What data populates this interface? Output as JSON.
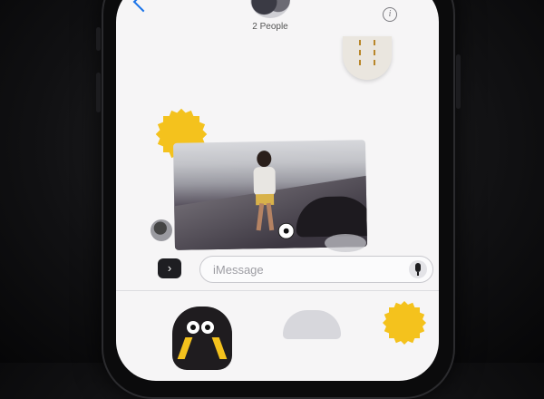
{
  "header": {
    "group_label": "2 People",
    "info_symbol": "i",
    "icons": {
      "back": "chevron-left-icon",
      "group_avatar": "group-avatar-icon",
      "info": "info-icon"
    }
  },
  "composer": {
    "placeholder": "iMessage",
    "apps_symbol": "›",
    "icons": {
      "apps": "app-drawer-icon",
      "mic": "microphone-icon"
    }
  },
  "colors": {
    "accent_blue": "#1a73e8",
    "sticker_yellow": "#f4c21d",
    "screen_bg": "#f6f5f6"
  }
}
